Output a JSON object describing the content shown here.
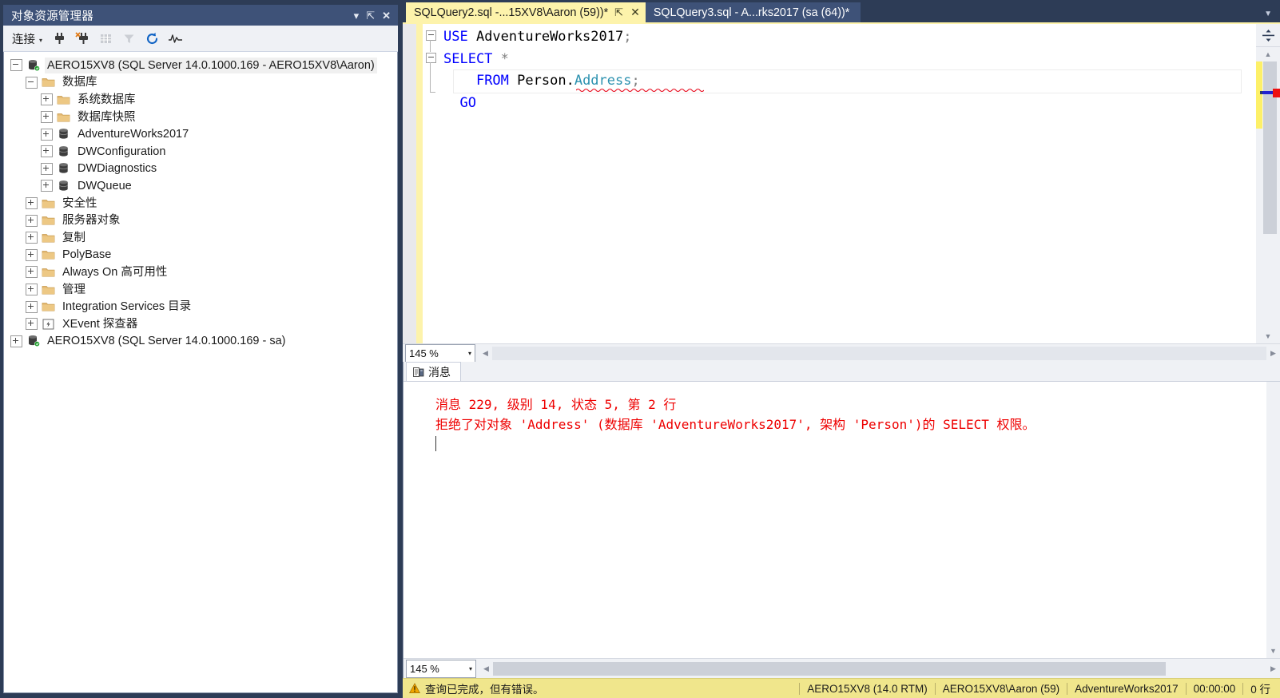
{
  "object_explorer": {
    "title": "对象资源管理器",
    "title_buttons": [
      {
        "name": "dropdown",
        "glyph": "▾"
      },
      {
        "name": "pin",
        "glyph": "⇱"
      },
      {
        "name": "close",
        "glyph": "✕"
      }
    ],
    "toolbar": {
      "connect_label": "连接",
      "connect_caret": "▾",
      "buttons": [
        {
          "name": "connect-icon",
          "title": "连接"
        },
        {
          "name": "disconnect-icon",
          "title": "断开连接"
        },
        {
          "name": "grid-icon",
          "title": "网格"
        },
        {
          "name": "filter-icon",
          "title": "筛选器"
        },
        {
          "name": "refresh-icon",
          "title": "刷新"
        },
        {
          "name": "activity-monitor-icon",
          "title": "活动监视器"
        }
      ]
    },
    "tree": [
      {
        "label": "AERO15XV8 (SQL Server 14.0.1000.169 - AERO15XV8\\Aaron)",
        "depth": 0,
        "icon": "server",
        "state": "expanded",
        "selected": true
      },
      {
        "label": "数据库",
        "depth": 1,
        "icon": "folder",
        "state": "expanded",
        "selected": false
      },
      {
        "label": "系统数据库",
        "depth": 2,
        "icon": "folder",
        "state": "collapsed",
        "selected": false
      },
      {
        "label": "数据库快照",
        "depth": 2,
        "icon": "folder",
        "state": "collapsed",
        "selected": false
      },
      {
        "label": "AdventureWorks2017",
        "depth": 2,
        "icon": "database",
        "state": "collapsed",
        "selected": false
      },
      {
        "label": "DWConfiguration",
        "depth": 2,
        "icon": "database",
        "state": "collapsed",
        "selected": false
      },
      {
        "label": "DWDiagnostics",
        "depth": 2,
        "icon": "database",
        "state": "collapsed",
        "selected": false
      },
      {
        "label": "DWQueue",
        "depth": 2,
        "icon": "database",
        "state": "collapsed",
        "selected": false
      },
      {
        "label": "安全性",
        "depth": 1,
        "icon": "folder",
        "state": "collapsed",
        "selected": false
      },
      {
        "label": "服务器对象",
        "depth": 1,
        "icon": "folder",
        "state": "collapsed",
        "selected": false
      },
      {
        "label": "复制",
        "depth": 1,
        "icon": "folder",
        "state": "collapsed",
        "selected": false
      },
      {
        "label": "PolyBase",
        "depth": 1,
        "icon": "folder",
        "state": "collapsed",
        "selected": false
      },
      {
        "label": "Always On 高可用性",
        "depth": 1,
        "icon": "folder",
        "state": "collapsed",
        "selected": false
      },
      {
        "label": "管理",
        "depth": 1,
        "icon": "folder",
        "state": "collapsed",
        "selected": false
      },
      {
        "label": "Integration Services 目录",
        "depth": 1,
        "icon": "folder",
        "state": "collapsed",
        "selected": false
      },
      {
        "label": "XEvent 探查器",
        "depth": 1,
        "icon": "xevent",
        "state": "collapsed",
        "selected": false
      },
      {
        "label": "AERO15XV8 (SQL Server 14.0.1000.169 - sa)",
        "depth": 0,
        "icon": "server",
        "state": "collapsed",
        "selected": false
      }
    ]
  },
  "tabs": [
    {
      "label": "SQLQuery2.sql -...15XV8\\Aaron (59))*",
      "active": true,
      "pin_glyph": "⇱",
      "close_glyph": "✕"
    },
    {
      "label": "SQLQuery3.sql - A...rks2017 (sa (64))*",
      "active": false
    }
  ],
  "tabstrip_overflow_caret": "▼",
  "editor": {
    "lines": [
      [
        {
          "t": "USE",
          "c": "kw"
        },
        {
          "t": " AdventureWorks2017",
          "c": "pl"
        },
        {
          "t": ";",
          "c": "op"
        }
      ],
      [
        {
          "t": "SELECT",
          "c": "kw"
        },
        {
          "t": " ",
          "c": "pl"
        },
        {
          "t": "*",
          "c": "op"
        }
      ],
      [
        {
          "t": "    ",
          "c": "pl"
        },
        {
          "t": "FROM",
          "c": "kw"
        },
        {
          "t": " ",
          "c": "pl"
        },
        {
          "t": "Person",
          "c": "sch"
        },
        {
          "t": ".",
          "c": "pl"
        },
        {
          "t": "Address",
          "c": "obj"
        },
        {
          "t": ";",
          "c": "op"
        }
      ],
      [
        {
          "t": "  ",
          "c": "pl"
        },
        {
          "t": "GO",
          "c": "kw"
        }
      ]
    ],
    "zoom_label": "145 %",
    "zoom_caret": "▾",
    "split_icon": "split-pane-icon"
  },
  "messages": {
    "tab_label": "消息",
    "tab_icon": "message-grid-icon",
    "lines": [
      "消息 229, 级别 14, 状态 5, 第 2 行",
      "拒绝了对对象 'Address' (数据库 'AdventureWorks2017', 架构 'Person')的 SELECT 权限。"
    ],
    "zoom_label": "145 %",
    "zoom_caret": "▾"
  },
  "statusbar": {
    "warning_icon": "warning-icon",
    "message": "查询已完成，但有错误。",
    "cells": [
      "AERO15XV8 (14.0 RTM)",
      "AERO15XV8\\Aaron (59)",
      "AdventureWorks2017",
      "00:00:00",
      "0 行"
    ]
  },
  "colors": {
    "chrome": "#2d3c56",
    "panel_title": "#3e5278",
    "active_tab": "#fdf3ab",
    "status_bar": "#f0e68c",
    "error_text": "#ee0000",
    "keyword": "#0000ff",
    "object": "#2b91af"
  }
}
